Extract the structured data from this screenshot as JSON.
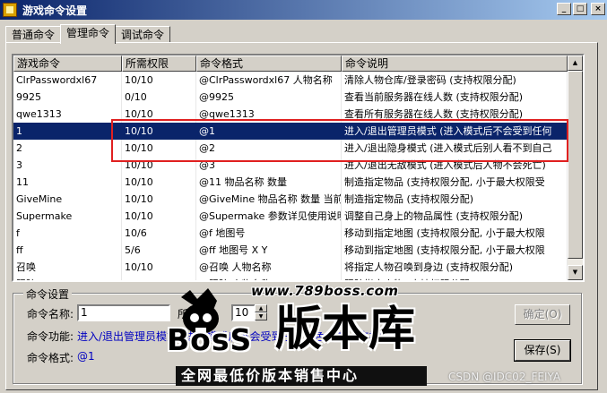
{
  "window": {
    "title": "游戏命令设置",
    "controls": [
      "_",
      "□",
      "×"
    ]
  },
  "tabs": [
    {
      "label": "普通命令",
      "active": false
    },
    {
      "label": "管理命令",
      "active": true
    },
    {
      "label": "调试命令",
      "active": false
    }
  ],
  "table": {
    "columns": [
      "游戏命令",
      "所需权限",
      "命令格式",
      "命令说明"
    ],
    "rows": [
      [
        "ClrPasswordxl67",
        "10/10",
        "@ClrPasswordxl67 人物名称",
        "清除人物仓库/登录密码 (支持权限分配)"
      ],
      [
        "9925",
        "0/10",
        "@9925",
        "查看当前服务器在线人数 (支持权限分配)"
      ],
      [
        "qwe1313",
        "10/10",
        "@qwe1313",
        "查看所有服务器在线人数 (支持权限分配)"
      ],
      [
        "1",
        "10/10",
        "@1",
        "进入/退出管理员模式 (进入模式后不会受到任何"
      ],
      [
        "2",
        "10/10",
        "@2",
        "进入/退出隐身模式 (进入模式后别人看不到自己"
      ],
      [
        "3",
        "10/10",
        "@3",
        "进入/退出无敌模式 (进入模式后人物不会死亡)"
      ],
      [
        "11",
        "10/10",
        "@11 物品名称 数量",
        "制造指定物品 (支持权限分配, 小于最大权限受"
      ],
      [
        "GiveMine",
        "10/10",
        "@GiveMine 物品名称 数量 当前",
        "制造指定物品 (支持权限分配)"
      ],
      [
        "Supermake",
        "10/10",
        "@Supermake 参数详见使用说明",
        "调整自己身上的物品属性 (支持权限分配)"
      ],
      [
        "f",
        "10/6",
        "@f 地图号",
        "移动到指定地图 (支持权限分配, 小于最大权限"
      ],
      [
        "ff",
        "5/6",
        "@ff 地图号 X Y",
        "移动到指定地图 (支持权限分配, 小于最大权限"
      ],
      [
        "召唤",
        "10/10",
        "@召唤 人物名称",
        "将指定人物召唤到身边 (支持权限分配)"
      ],
      [
        "跟踪",
        "10/10",
        "@跟踪 人物名称",
        "跟踪指定人物 (支持权限分配)"
      ]
    ],
    "selected_row": 3
  },
  "settings": {
    "group_title": "命令设置",
    "name_label": "命令名称:",
    "name_value": "1",
    "perm_label": "所需",
    "perm_value": "10",
    "func_label": "命令功能:",
    "func_value": "进入/退出管理员模式 (进入模式后不会受到任何角色攻击) (支持权限分配)",
    "format_label": "命令格式:",
    "format_value": "@1",
    "confirm_label": "确定(O)",
    "save_label": "保存(S)"
  },
  "watermark": {
    "url": "www.789boss.com",
    "logo_text": "BosS",
    "brand": "版本库",
    "slogan": "全网最低价版本销售中心",
    "credit": "CSDN @IDC02_FEIYA"
  },
  "colors": {
    "selection": "#0a246a",
    "highlight_box": "#e02020",
    "title_gradient_start": "#0a246a",
    "title_gradient_end": "#a6caf0"
  }
}
